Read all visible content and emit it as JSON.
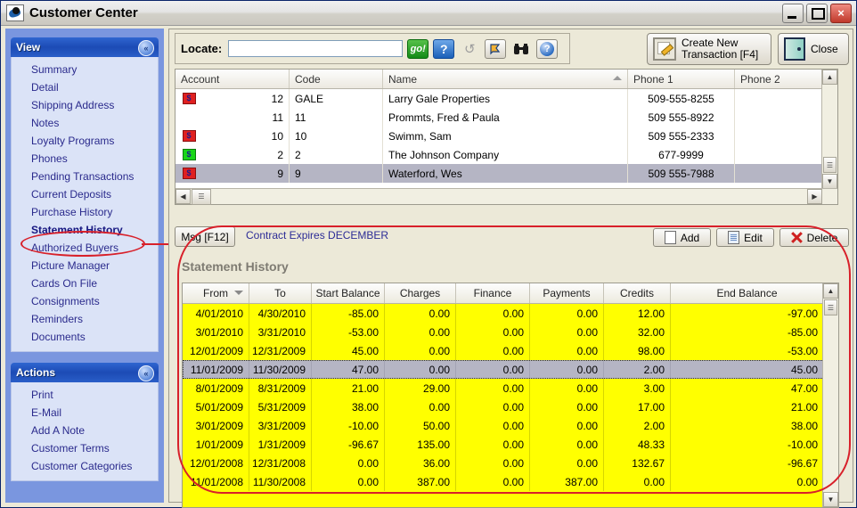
{
  "window": {
    "title": "Customer Center",
    "icon": "app-icon",
    "minimize": "minimize",
    "maximize": "maximize",
    "close": "×"
  },
  "sidebar": {
    "view_panel": {
      "title": "View",
      "collapse_icon": "«",
      "items": [
        {
          "label": "Summary",
          "selected": false
        },
        {
          "label": "Detail",
          "selected": false
        },
        {
          "label": "Shipping Address",
          "selected": false
        },
        {
          "label": "Notes",
          "selected": false
        },
        {
          "label": "Loyalty Programs",
          "selected": false
        },
        {
          "label": "Phones",
          "selected": false
        },
        {
          "label": "Pending Transactions",
          "selected": false
        },
        {
          "label": "Current Deposits",
          "selected": false
        },
        {
          "label": "Purchase History",
          "selected": false
        },
        {
          "label": "Statement History",
          "selected": true
        },
        {
          "label": "Authorized Buyers",
          "selected": false
        },
        {
          "label": "Picture Manager",
          "selected": false
        },
        {
          "label": "Cards On File",
          "selected": false
        },
        {
          "label": "Consignments",
          "selected": false
        },
        {
          "label": "Reminders",
          "selected": false
        },
        {
          "label": "Documents",
          "selected": false
        }
      ]
    },
    "actions_panel": {
      "title": "Actions",
      "collapse_icon": "«",
      "items": [
        {
          "label": "Print"
        },
        {
          "label": "E-Mail"
        },
        {
          "label": "Add A Note"
        },
        {
          "label": "Customer Terms"
        },
        {
          "label": "Customer Categories"
        }
      ]
    }
  },
  "toolbar": {
    "locate_label": "Locate:",
    "locate_value": "",
    "locate_placeholder": "",
    "go_label": "go!",
    "help_label": "?",
    "refresh_label": "↺",
    "flag_label": "",
    "binoculars_label": "",
    "about_label": "?",
    "create_line1": "Create New",
    "create_line2": "Transaction [F4]",
    "close_label": "Close"
  },
  "customer_grid": {
    "columns": [
      "Account",
      "Code",
      "Name",
      "Phone 1",
      "Phone 2"
    ],
    "sort_column": "Name",
    "rows": [
      {
        "flag": "red",
        "account": "12",
        "code": "GALE",
        "name": "Larry Gale Properties",
        "phone1": "509-555-8255",
        "phone2": "",
        "selected": false
      },
      {
        "flag": "none",
        "account": "11",
        "code": "11",
        "name": "Prommts, Fred & Paula",
        "phone1": "509  555-8922",
        "phone2": "",
        "selected": false
      },
      {
        "flag": "red",
        "account": "10",
        "code": "10",
        "name": "Swimm, Sam",
        "phone1": "509  555-2333",
        "phone2": "",
        "selected": false
      },
      {
        "flag": "green",
        "account": "2",
        "code": "2",
        "name": "The Johnson Company",
        "phone1": "677-9999",
        "phone2": "",
        "selected": false
      },
      {
        "flag": "red",
        "account": "9",
        "code": "9",
        "name": "Waterford, Wes",
        "phone1": "509  555-7988",
        "phone2": "",
        "selected": true
      }
    ]
  },
  "msgbar": {
    "msg_button": "Msg [F12]",
    "contract_text": "Contract Expires DECEMBER",
    "add_label": "Add",
    "edit_label": "Edit",
    "delete_label": "Delete"
  },
  "statement_history": {
    "title": "Statement History",
    "columns": [
      "From",
      "To",
      "Start Balance",
      "Charges",
      "Finance",
      "Payments",
      "Credits",
      "End Balance"
    ],
    "sort_column": "From",
    "rows": [
      {
        "from": "4/01/2010",
        "to": "4/30/2010",
        "start": "-85.00",
        "charges": "0.00",
        "finance": "0.00",
        "payments": "0.00",
        "credits": "12.00",
        "end": "-97.00",
        "selected": false
      },
      {
        "from": "3/01/2010",
        "to": "3/31/2010",
        "start": "-53.00",
        "charges": "0.00",
        "finance": "0.00",
        "payments": "0.00",
        "credits": "32.00",
        "end": "-85.00",
        "selected": false
      },
      {
        "from": "12/01/2009",
        "to": "12/31/2009",
        "start": "45.00",
        "charges": "0.00",
        "finance": "0.00",
        "payments": "0.00",
        "credits": "98.00",
        "end": "-53.00",
        "selected": false
      },
      {
        "from": "11/01/2009",
        "to": "11/30/2009",
        "start": "47.00",
        "charges": "0.00",
        "finance": "0.00",
        "payments": "0.00",
        "credits": "2.00",
        "end": "45.00",
        "selected": true
      },
      {
        "from": "8/01/2009",
        "to": "8/31/2009",
        "start": "21.00",
        "charges": "29.00",
        "finance": "0.00",
        "payments": "0.00",
        "credits": "3.00",
        "end": "47.00",
        "selected": false
      },
      {
        "from": "5/01/2009",
        "to": "5/31/2009",
        "start": "38.00",
        "charges": "0.00",
        "finance": "0.00",
        "payments": "0.00",
        "credits": "17.00",
        "end": "21.00",
        "selected": false
      },
      {
        "from": "3/01/2009",
        "to": "3/31/2009",
        "start": "-10.00",
        "charges": "50.00",
        "finance": "0.00",
        "payments": "0.00",
        "credits": "2.00",
        "end": "38.00",
        "selected": false
      },
      {
        "from": "1/01/2009",
        "to": "1/31/2009",
        "start": "-96.67",
        "charges": "135.00",
        "finance": "0.00",
        "payments": "0.00",
        "credits": "48.33",
        "end": "-10.00",
        "selected": false
      },
      {
        "from": "12/01/2008",
        "to": "12/31/2008",
        "start": "0.00",
        "charges": "36.00",
        "finance": "0.00",
        "payments": "0.00",
        "credits": "132.67",
        "end": "-96.67",
        "selected": false
      },
      {
        "from": "11/01/2008",
        "to": "11/30/2008",
        "start": "0.00",
        "charges": "387.00",
        "finance": "0.00",
        "payments": "387.00",
        "credits": "0.00",
        "end": "0.00",
        "selected": false
      }
    ]
  },
  "colors": {
    "grid_highlight": "#ffff00",
    "selected_row": "#b5b5c4",
    "annotation": "#d8202a",
    "panel_header": "#1c4bb5",
    "sidebar_bg": "#7a96df"
  }
}
